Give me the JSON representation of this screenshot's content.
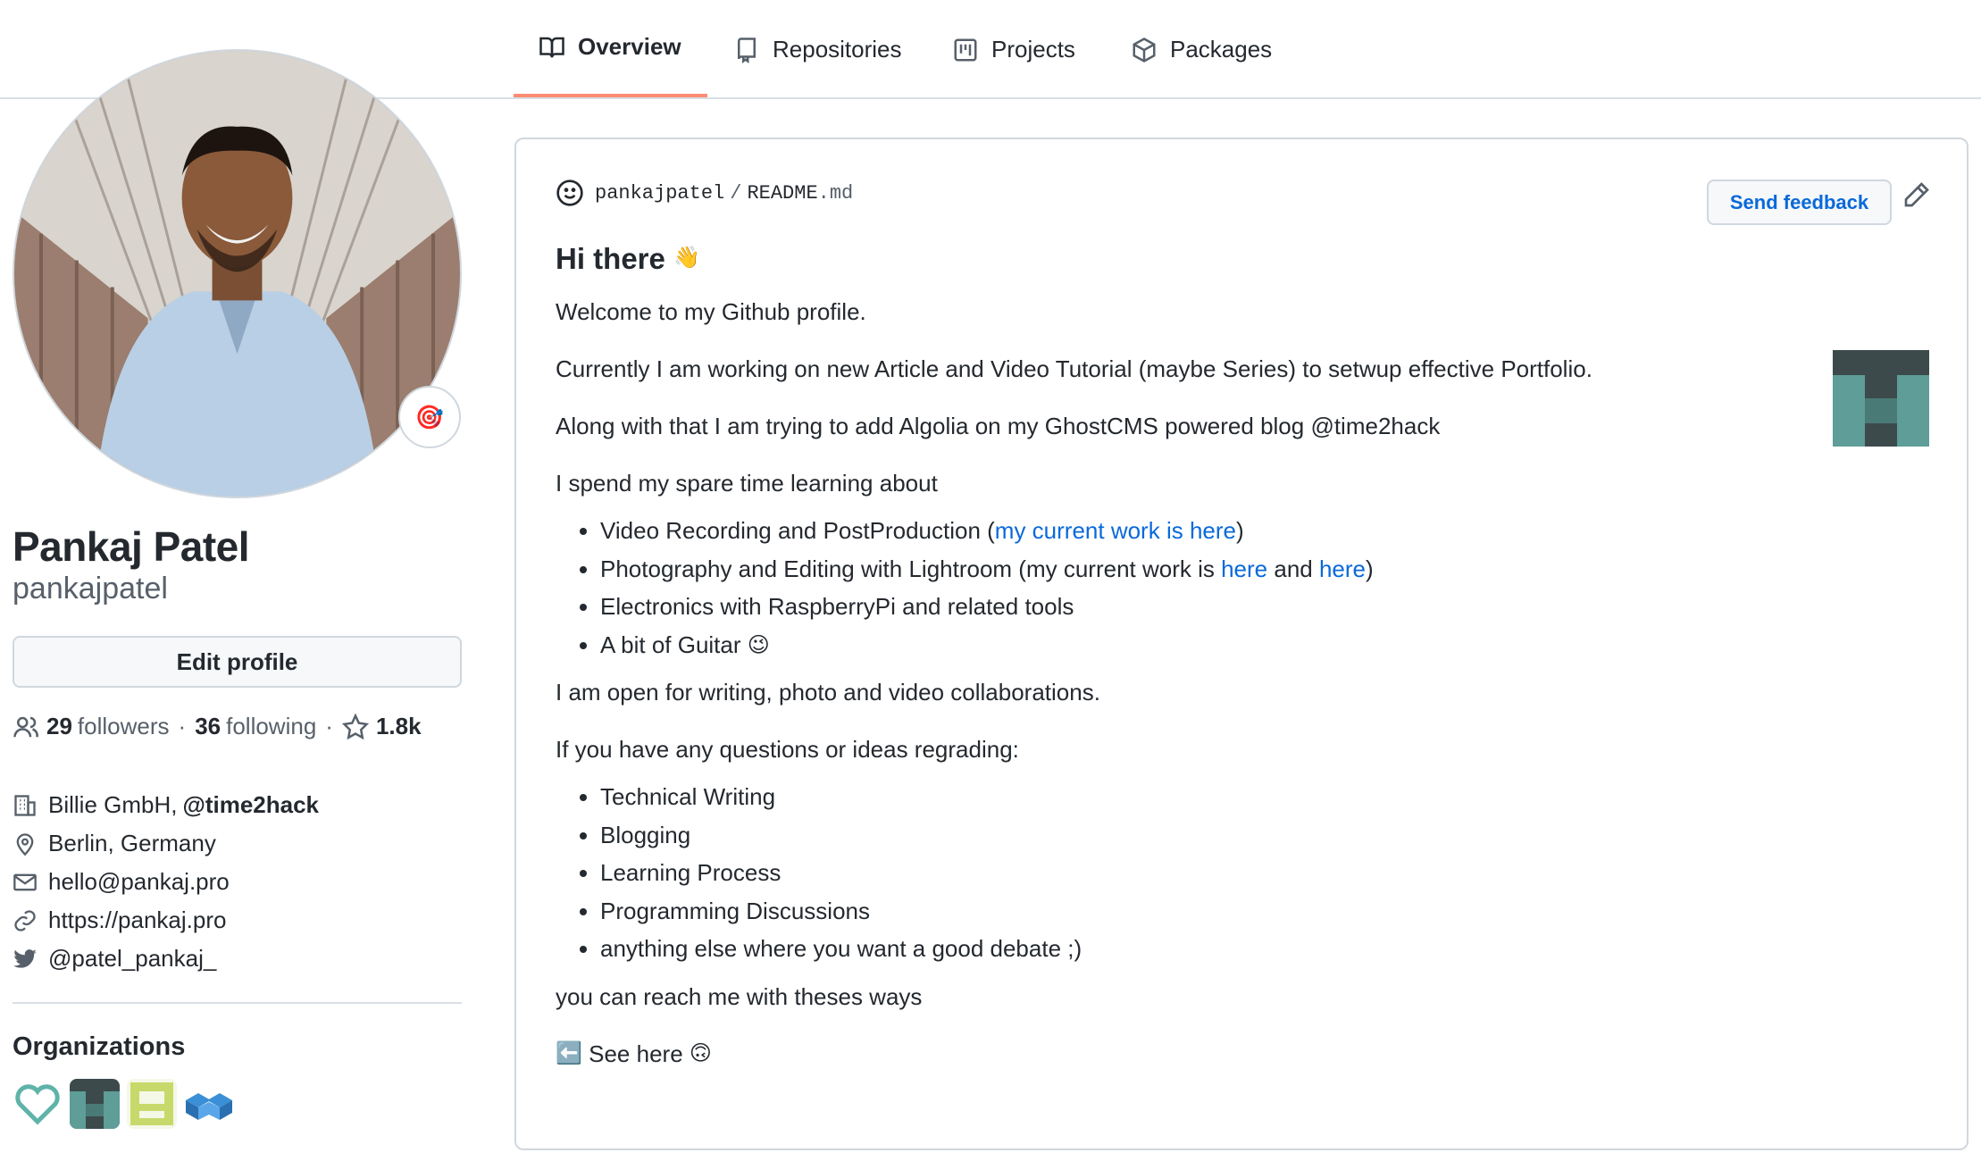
{
  "tabs": [
    {
      "label": "Overview",
      "icon": "book-icon",
      "active": true
    },
    {
      "label": "Repositories",
      "icon": "repo-icon",
      "active": false
    },
    {
      "label": "Projects",
      "icon": "project-icon",
      "active": false
    },
    {
      "label": "Packages",
      "icon": "package-icon",
      "active": false
    }
  ],
  "profile": {
    "name": "Pankaj Patel",
    "username": "pankajpatel",
    "status_emoji": "🎯",
    "edit_label": "Edit profile",
    "followers_count": "29",
    "followers_label": "followers",
    "following_count": "36",
    "following_label": "following",
    "stars_count": "1.8k",
    "separator": "·",
    "company": "Billie GmbH,",
    "company_handle": "@time2hack",
    "location": "Berlin, Germany",
    "email": "hello@pankaj.pro",
    "website": "https://pankaj.pro",
    "twitter": "@patel_pankaj_"
  },
  "organizations": {
    "title": "Organizations",
    "items": [
      "heart-org-logo",
      "time2hack-org-logo",
      "pixel-org-logo",
      "cube-org-logo"
    ]
  },
  "readme": {
    "owner": "pankajpatel",
    "separator": "/",
    "file_name": "README",
    "file_ext": ".md",
    "feedback_label": "Send feedback",
    "heading": "Hi there",
    "heading_emoji": "👋",
    "p1": "Welcome to my Github profile.",
    "p2": "Currently I am working on new Article and Video Tutorial (maybe Series) to setwup effective Portfolio.",
    "p3": "Along with that I am trying to add Algolia on my GhostCMS powered blog @time2hack",
    "p4": "I spend my spare time learning about",
    "learn": {
      "item1_pre": "Video Recording and PostProduction (",
      "item1_link": "my current work is here",
      "item1_post": ")",
      "item2_pre": "Photography and Editing with Lightroom (my current work is ",
      "item2_link1": "here",
      "item2_mid": " and ",
      "item2_link2": "here",
      "item2_post": ")",
      "item3": "Electronics with RaspberryPi and related tools",
      "item4": "A bit of Guitar",
      "item4_emoji": "😉"
    },
    "p5": "I am open for writing, photo and video collaborations.",
    "p6": "If you have any questions or ideas regrading:",
    "topics": [
      "Technical Writing",
      "Blogging",
      "Learning Process",
      "Programming Discussions",
      "anything else where you want a good debate ;)"
    ],
    "p7": "you can reach me with theses ways",
    "see_here_emoji": "⬅️",
    "see_here": "See here",
    "see_here_emoji2": "🙃"
  }
}
